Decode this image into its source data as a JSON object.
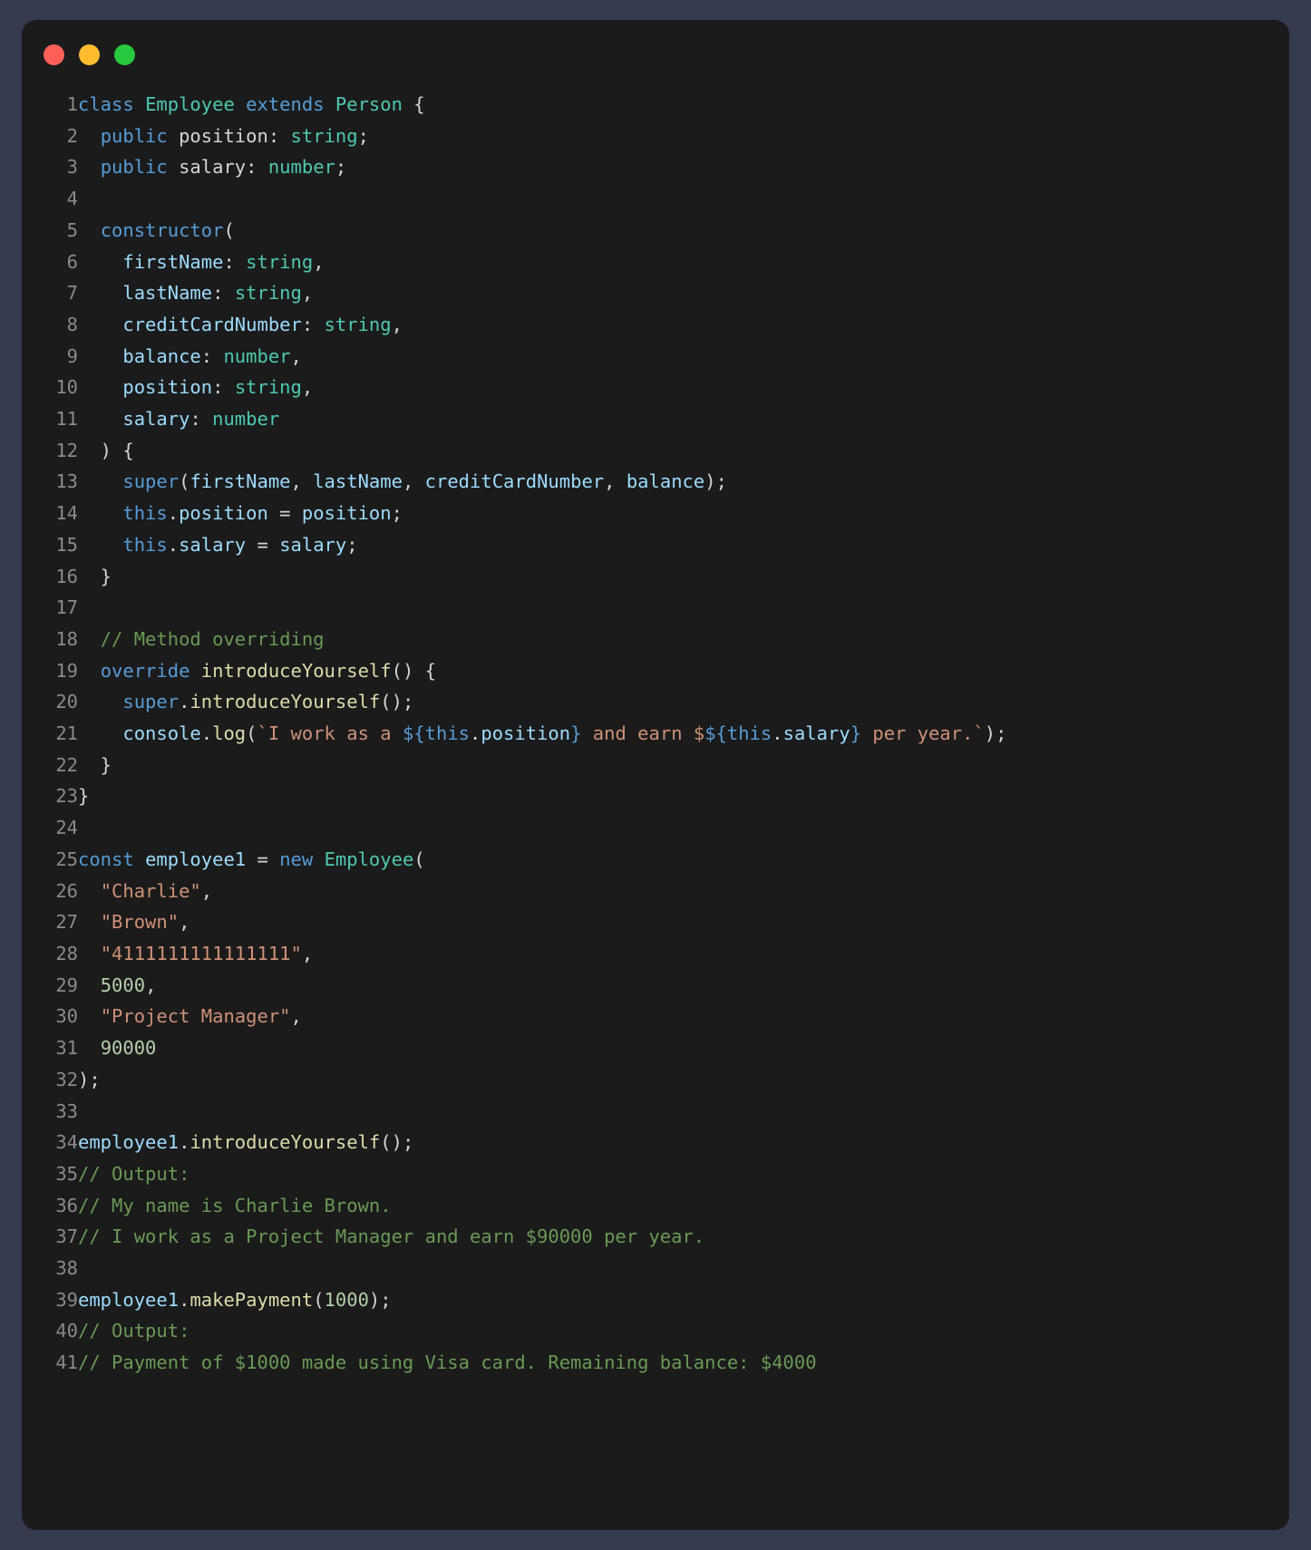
{
  "window": {
    "title_bar": {
      "buttons": [
        {
          "name": "close",
          "color": "#ff5f57",
          "label": ""
        },
        {
          "name": "minimize",
          "color": "#febc2e",
          "label": ""
        },
        {
          "name": "maximize",
          "color": "#28c840",
          "label": ""
        }
      ]
    },
    "background": "#353a4f",
    "panel_background": "#1b1b1b"
  },
  "editor": {
    "language": "typescript",
    "theme_colors": {
      "keyword": "#569cd6",
      "type": "#4ec9b0",
      "identifier": "#9cdcfe",
      "function": "#dcdcaa",
      "string": "#ce9178",
      "number": "#b5cea8",
      "comment": "#6a9955",
      "punctuation": "#d4d4d4",
      "line_number": "#8a8a8a"
    },
    "line_numbers": [
      "1",
      "2",
      "3",
      "4",
      "5",
      "6",
      "7",
      "8",
      "9",
      "10",
      "11",
      "12",
      "13",
      "14",
      "15",
      "16",
      "17",
      "18",
      "19",
      "20",
      "21",
      "22",
      "23",
      "24",
      "25",
      "26",
      "27",
      "28",
      "29",
      "30",
      "31",
      "32",
      "33",
      "34",
      "35",
      "36",
      "37",
      "38",
      "39",
      "40",
      "41"
    ],
    "lines": [
      {
        "n": "1",
        "text": "class Employee extends Person {"
      },
      {
        "n": "2",
        "text": "  public position: string;"
      },
      {
        "n": "3",
        "text": "  public salary: number;"
      },
      {
        "n": "4",
        "text": ""
      },
      {
        "n": "5",
        "text": "  constructor("
      },
      {
        "n": "6",
        "text": "    firstName: string,"
      },
      {
        "n": "7",
        "text": "    lastName: string,"
      },
      {
        "n": "8",
        "text": "    creditCardNumber: string,"
      },
      {
        "n": "9",
        "text": "    balance: number,"
      },
      {
        "n": "10",
        "text": "    position: string,"
      },
      {
        "n": "11",
        "text": "    salary: number"
      },
      {
        "n": "12",
        "text": "  ) {"
      },
      {
        "n": "13",
        "text": "    super(firstName, lastName, creditCardNumber, balance);"
      },
      {
        "n": "14",
        "text": "    this.position = position;"
      },
      {
        "n": "15",
        "text": "    this.salary = salary;"
      },
      {
        "n": "16",
        "text": "  }"
      },
      {
        "n": "17",
        "text": ""
      },
      {
        "n": "18",
        "text": "  // Method overriding"
      },
      {
        "n": "19",
        "text": "  override introduceYourself() {"
      },
      {
        "n": "20",
        "text": "    super.introduceYourself();"
      },
      {
        "n": "21",
        "text": "    console.log(`I work as a ${this.position} and earn $${this.salary} per year.`);"
      },
      {
        "n": "22",
        "text": "  }"
      },
      {
        "n": "23",
        "text": "}"
      },
      {
        "n": "24",
        "text": ""
      },
      {
        "n": "25",
        "text": "const employee1 = new Employee("
      },
      {
        "n": "26",
        "text": "  \"Charlie\","
      },
      {
        "n": "27",
        "text": "  \"Brown\","
      },
      {
        "n": "28",
        "text": "  \"4111111111111111\","
      },
      {
        "n": "29",
        "text": "  5000,"
      },
      {
        "n": "30",
        "text": "  \"Project Manager\","
      },
      {
        "n": "31",
        "text": "  90000"
      },
      {
        "n": "32",
        "text": ");"
      },
      {
        "n": "33",
        "text": ""
      },
      {
        "n": "34",
        "text": "employee1.introduceYourself();"
      },
      {
        "n": "35",
        "text": "// Output:"
      },
      {
        "n": "36",
        "text": "// My name is Charlie Brown."
      },
      {
        "n": "37",
        "text": "// I work as a Project Manager and earn $90000 per year."
      },
      {
        "n": "38",
        "text": ""
      },
      {
        "n": "39",
        "text": "employee1.makePayment(1000);"
      },
      {
        "n": "40",
        "text": "// Output:"
      },
      {
        "n": "41",
        "text": "// Payment of $1000 made using Visa card. Remaining balance: $4000"
      }
    ],
    "tokens": [
      [
        {
          "t": "class ",
          "c": "kw"
        },
        {
          "t": "Employee",
          "c": "typ"
        },
        {
          "t": " ",
          "c": "pun"
        },
        {
          "t": "extends",
          "c": "kw"
        },
        {
          "t": " ",
          "c": "pun"
        },
        {
          "t": "Person",
          "c": "typ"
        },
        {
          "t": " {",
          "c": "pun"
        }
      ],
      [
        {
          "t": "  ",
          "c": "pun"
        },
        {
          "t": "public",
          "c": "kw"
        },
        {
          "t": " ",
          "c": "pun"
        },
        {
          "t": "position",
          "c": "pun"
        },
        {
          "t": ": ",
          "c": "pun"
        },
        {
          "t": "string",
          "c": "typ"
        },
        {
          "t": ";",
          "c": "pun"
        }
      ],
      [
        {
          "t": "  ",
          "c": "pun"
        },
        {
          "t": "public",
          "c": "kw"
        },
        {
          "t": " ",
          "c": "pun"
        },
        {
          "t": "salary",
          "c": "pun"
        },
        {
          "t": ": ",
          "c": "pun"
        },
        {
          "t": "number",
          "c": "typ"
        },
        {
          "t": ";",
          "c": "pun"
        }
      ],
      [],
      [
        {
          "t": "  ",
          "c": "pun"
        },
        {
          "t": "constructor",
          "c": "kw"
        },
        {
          "t": "(",
          "c": "pun"
        }
      ],
      [
        {
          "t": "    ",
          "c": "pun"
        },
        {
          "t": "firstName",
          "c": "id"
        },
        {
          "t": ": ",
          "c": "pun"
        },
        {
          "t": "string",
          "c": "typ"
        },
        {
          "t": ",",
          "c": "pun"
        }
      ],
      [
        {
          "t": "    ",
          "c": "pun"
        },
        {
          "t": "lastName",
          "c": "id"
        },
        {
          "t": ": ",
          "c": "pun"
        },
        {
          "t": "string",
          "c": "typ"
        },
        {
          "t": ",",
          "c": "pun"
        }
      ],
      [
        {
          "t": "    ",
          "c": "pun"
        },
        {
          "t": "creditCardNumber",
          "c": "id"
        },
        {
          "t": ": ",
          "c": "pun"
        },
        {
          "t": "string",
          "c": "typ"
        },
        {
          "t": ",",
          "c": "pun"
        }
      ],
      [
        {
          "t": "    ",
          "c": "pun"
        },
        {
          "t": "balance",
          "c": "id"
        },
        {
          "t": ": ",
          "c": "pun"
        },
        {
          "t": "number",
          "c": "typ"
        },
        {
          "t": ",",
          "c": "pun"
        }
      ],
      [
        {
          "t": "    ",
          "c": "pun"
        },
        {
          "t": "position",
          "c": "id"
        },
        {
          "t": ": ",
          "c": "pun"
        },
        {
          "t": "string",
          "c": "typ"
        },
        {
          "t": ",",
          "c": "pun"
        }
      ],
      [
        {
          "t": "    ",
          "c": "pun"
        },
        {
          "t": "salary",
          "c": "id"
        },
        {
          "t": ": ",
          "c": "pun"
        },
        {
          "t": "number",
          "c": "typ"
        }
      ],
      [
        {
          "t": "  ) {",
          "c": "pun"
        }
      ],
      [
        {
          "t": "    ",
          "c": "pun"
        },
        {
          "t": "super",
          "c": "kw"
        },
        {
          "t": "(",
          "c": "pun"
        },
        {
          "t": "firstName",
          "c": "id"
        },
        {
          "t": ", ",
          "c": "pun"
        },
        {
          "t": "lastName",
          "c": "id"
        },
        {
          "t": ", ",
          "c": "pun"
        },
        {
          "t": "creditCardNumber",
          "c": "id"
        },
        {
          "t": ", ",
          "c": "pun"
        },
        {
          "t": "balance",
          "c": "id"
        },
        {
          "t": ");",
          "c": "pun"
        }
      ],
      [
        {
          "t": "    ",
          "c": "pun"
        },
        {
          "t": "this",
          "c": "kw"
        },
        {
          "t": ".",
          "c": "pun"
        },
        {
          "t": "position",
          "c": "id"
        },
        {
          "t": " = ",
          "c": "pun"
        },
        {
          "t": "position",
          "c": "id"
        },
        {
          "t": ";",
          "c": "pun"
        }
      ],
      [
        {
          "t": "    ",
          "c": "pun"
        },
        {
          "t": "this",
          "c": "kw"
        },
        {
          "t": ".",
          "c": "pun"
        },
        {
          "t": "salary",
          "c": "id"
        },
        {
          "t": " = ",
          "c": "pun"
        },
        {
          "t": "salary",
          "c": "id"
        },
        {
          "t": ";",
          "c": "pun"
        }
      ],
      [
        {
          "t": "  }",
          "c": "pun"
        }
      ],
      [],
      [
        {
          "t": "  ",
          "c": "pun"
        },
        {
          "t": "// Method overriding",
          "c": "cmt"
        }
      ],
      [
        {
          "t": "  ",
          "c": "pun"
        },
        {
          "t": "override",
          "c": "kw"
        },
        {
          "t": " ",
          "c": "pun"
        },
        {
          "t": "introduceYourself",
          "c": "fn"
        },
        {
          "t": "() {",
          "c": "pun"
        }
      ],
      [
        {
          "t": "    ",
          "c": "pun"
        },
        {
          "t": "super",
          "c": "kw"
        },
        {
          "t": ".",
          "c": "pun"
        },
        {
          "t": "introduceYourself",
          "c": "fn"
        },
        {
          "t": "();",
          "c": "pun"
        }
      ],
      [
        {
          "t": "    ",
          "c": "pun"
        },
        {
          "t": "console",
          "c": "id"
        },
        {
          "t": ".",
          "c": "pun"
        },
        {
          "t": "log",
          "c": "fn"
        },
        {
          "t": "(",
          "c": "pun"
        },
        {
          "t": "`I work as a ",
          "c": "str"
        },
        {
          "t": "${",
          "c": "tpl"
        },
        {
          "t": "this",
          "c": "kw"
        },
        {
          "t": ".",
          "c": "pun"
        },
        {
          "t": "position",
          "c": "id"
        },
        {
          "t": "}",
          "c": "tpl"
        },
        {
          "t": " and earn $",
          "c": "str"
        },
        {
          "t": "${",
          "c": "tpl"
        },
        {
          "t": "this",
          "c": "kw"
        },
        {
          "t": ".",
          "c": "pun"
        },
        {
          "t": "salary",
          "c": "id"
        },
        {
          "t": "}",
          "c": "tpl"
        },
        {
          "t": " per year.`",
          "c": "str"
        },
        {
          "t": ");",
          "c": "pun"
        }
      ],
      [
        {
          "t": "  }",
          "c": "pun"
        }
      ],
      [
        {
          "t": "}",
          "c": "pun"
        }
      ],
      [],
      [
        {
          "t": "const",
          "c": "kw"
        },
        {
          "t": " ",
          "c": "pun"
        },
        {
          "t": "employee1",
          "c": "id"
        },
        {
          "t": " = ",
          "c": "pun"
        },
        {
          "t": "new",
          "c": "kw"
        },
        {
          "t": " ",
          "c": "pun"
        },
        {
          "t": "Employee",
          "c": "typ"
        },
        {
          "t": "(",
          "c": "pun"
        }
      ],
      [
        {
          "t": "  ",
          "c": "pun"
        },
        {
          "t": "\"Charlie\"",
          "c": "str"
        },
        {
          "t": ",",
          "c": "pun"
        }
      ],
      [
        {
          "t": "  ",
          "c": "pun"
        },
        {
          "t": "\"Brown\"",
          "c": "str"
        },
        {
          "t": ",",
          "c": "pun"
        }
      ],
      [
        {
          "t": "  ",
          "c": "pun"
        },
        {
          "t": "\"4111111111111111\"",
          "c": "str"
        },
        {
          "t": ",",
          "c": "pun"
        }
      ],
      [
        {
          "t": "  ",
          "c": "pun"
        },
        {
          "t": "5000",
          "c": "num"
        },
        {
          "t": ",",
          "c": "pun"
        }
      ],
      [
        {
          "t": "  ",
          "c": "pun"
        },
        {
          "t": "\"Project Manager\"",
          "c": "str"
        },
        {
          "t": ",",
          "c": "pun"
        }
      ],
      [
        {
          "t": "  ",
          "c": "pun"
        },
        {
          "t": "90000",
          "c": "num"
        }
      ],
      [
        {
          "t": ");",
          "c": "pun"
        }
      ],
      [],
      [
        {
          "t": "employee1",
          "c": "id"
        },
        {
          "t": ".",
          "c": "pun"
        },
        {
          "t": "introduceYourself",
          "c": "fn"
        },
        {
          "t": "();",
          "c": "pun"
        }
      ],
      [
        {
          "t": "// Output:",
          "c": "cmt"
        }
      ],
      [
        {
          "t": "// My name is Charlie Brown.",
          "c": "cmt"
        }
      ],
      [
        {
          "t": "// I work as a Project Manager and earn $90000 per year.",
          "c": "cmt"
        }
      ],
      [],
      [
        {
          "t": "employee1",
          "c": "id"
        },
        {
          "t": ".",
          "c": "pun"
        },
        {
          "t": "makePayment",
          "c": "fn"
        },
        {
          "t": "(",
          "c": "pun"
        },
        {
          "t": "1000",
          "c": "num"
        },
        {
          "t": ");",
          "c": "pun"
        }
      ],
      [
        {
          "t": "// Output:",
          "c": "cmt"
        }
      ],
      [
        {
          "t": "// Payment of $1000 made using Visa card. Remaining balance: $4000",
          "c": "cmt"
        }
      ]
    ]
  }
}
